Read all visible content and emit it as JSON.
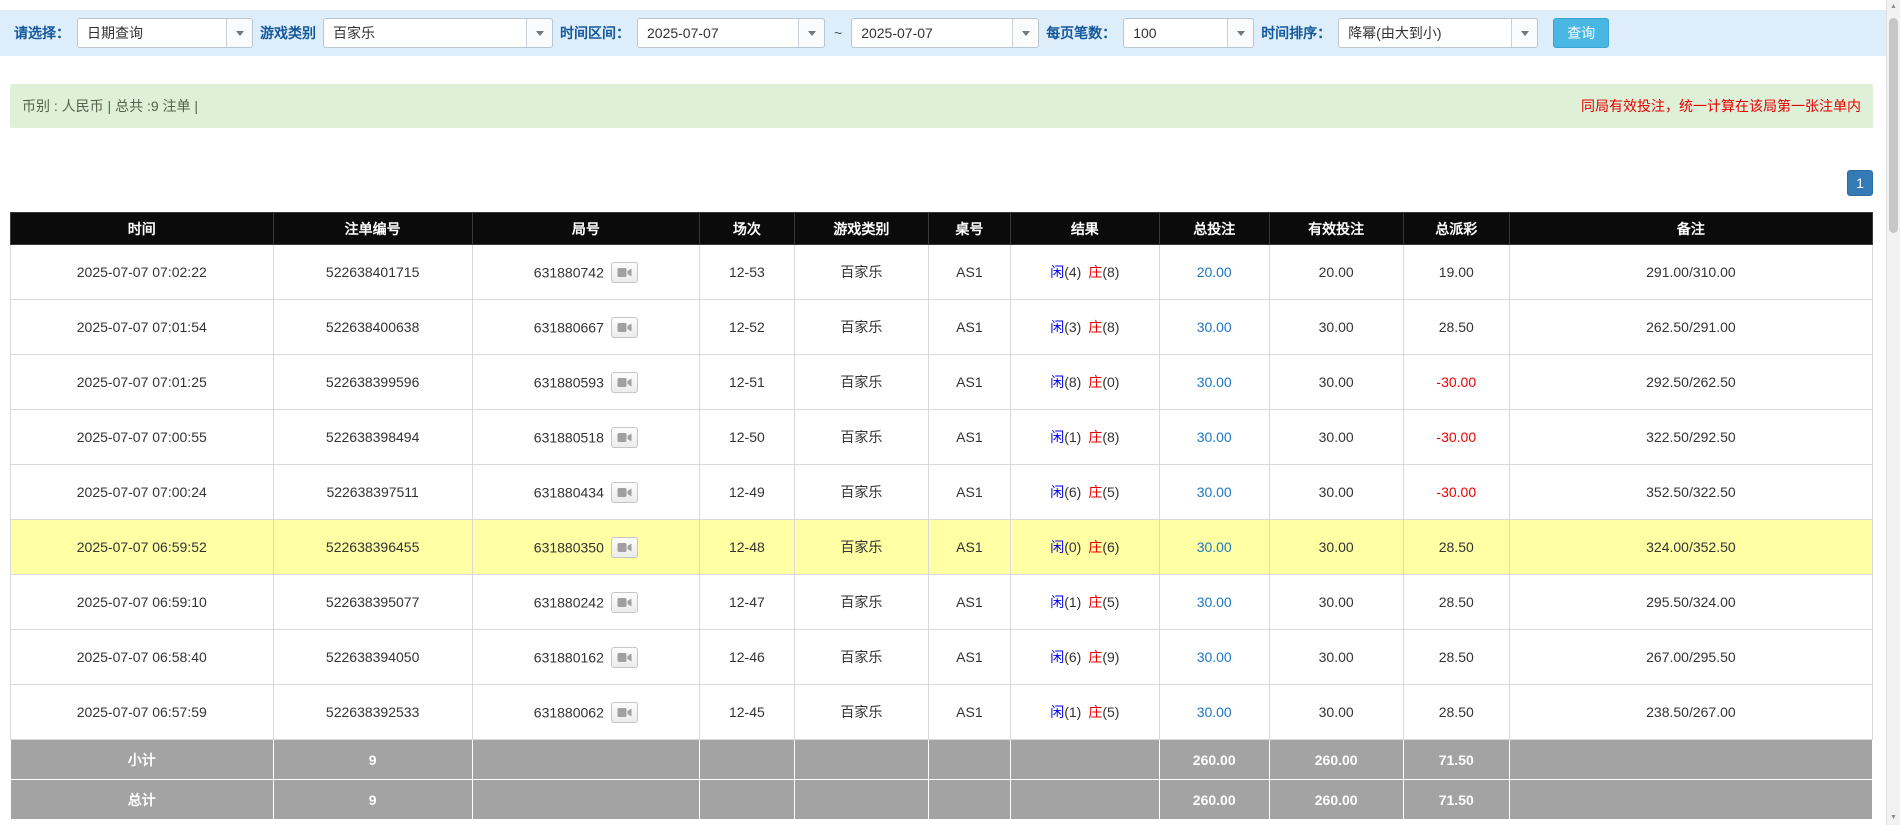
{
  "filter": {
    "select_label": "请选择：",
    "select_value": "日期查询",
    "game_label": "游戏类别",
    "game_value": "百家乐",
    "range_label": "时间区间：",
    "date_from": "2025-07-07",
    "range_sep": "~",
    "date_to": "2025-07-07",
    "per_page_label": "每页笔数：",
    "per_page_value": "100",
    "sort_label": "时间排序：",
    "sort_value": "降幂(由大到小)",
    "query_button": "查询"
  },
  "summary": {
    "left": "币别 : 人民币 | 总共 :9 注单 |",
    "right": "同局有效投注，统一计算在该局第一张注单内"
  },
  "pagination": {
    "current_page": "1"
  },
  "table": {
    "headers": [
      "时间",
      "注单编号",
      "局号",
      "场次",
      "游戏类别",
      "桌号",
      "结果",
      "总投注",
      "有效投注",
      "总派彩",
      "备注"
    ],
    "rows": [
      {
        "time": "2025-07-07 07:02:22",
        "bet_id": "522638401715",
        "round": "631880742",
        "session": "12-53",
        "game": "百家乐",
        "table_no": "AS1",
        "player": "闲",
        "player_score": "(4)",
        "banker": "庄",
        "banker_score": "(8)",
        "total_bet": "20.00",
        "valid_bet": "20.00",
        "payout": "19.00",
        "remark": "291.00/310.00",
        "highlighted": false
      },
      {
        "time": "2025-07-07 07:01:54",
        "bet_id": "522638400638",
        "round": "631880667",
        "session": "12-52",
        "game": "百家乐",
        "table_no": "AS1",
        "player": "闲",
        "player_score": "(3)",
        "banker": "庄",
        "banker_score": "(8)",
        "total_bet": "30.00",
        "valid_bet": "30.00",
        "payout": "28.50",
        "remark": "262.50/291.00",
        "highlighted": false
      },
      {
        "time": "2025-07-07 07:01:25",
        "bet_id": "522638399596",
        "round": "631880593",
        "session": "12-51",
        "game": "百家乐",
        "table_no": "AS1",
        "player": "闲",
        "player_score": "(8)",
        "banker": "庄",
        "banker_score": "(0)",
        "total_bet": "30.00",
        "valid_bet": "30.00",
        "payout": "-30.00",
        "remark": "292.50/262.50",
        "highlighted": false
      },
      {
        "time": "2025-07-07 07:00:55",
        "bet_id": "522638398494",
        "round": "631880518",
        "session": "12-50",
        "game": "百家乐",
        "table_no": "AS1",
        "player": "闲",
        "player_score": "(1)",
        "banker": "庄",
        "banker_score": "(8)",
        "total_bet": "30.00",
        "valid_bet": "30.00",
        "payout": "-30.00",
        "remark": "322.50/292.50",
        "highlighted": false
      },
      {
        "time": "2025-07-07 07:00:24",
        "bet_id": "522638397511",
        "round": "631880434",
        "session": "12-49",
        "game": "百家乐",
        "table_no": "AS1",
        "player": "闲",
        "player_score": "(6)",
        "banker": "庄",
        "banker_score": "(5)",
        "total_bet": "30.00",
        "valid_bet": "30.00",
        "payout": "-30.00",
        "remark": "352.50/322.50",
        "highlighted": false
      },
      {
        "time": "2025-07-07 06:59:52",
        "bet_id": "522638396455",
        "round": "631880350",
        "session": "12-48",
        "game": "百家乐",
        "table_no": "AS1",
        "player": "闲",
        "player_score": "(0)",
        "banker": "庄",
        "banker_score": "(6)",
        "total_bet": "30.00",
        "valid_bet": "30.00",
        "payout": "28.50",
        "remark": "324.00/352.50",
        "highlighted": true
      },
      {
        "time": "2025-07-07 06:59:10",
        "bet_id": "522638395077",
        "round": "631880242",
        "session": "12-47",
        "game": "百家乐",
        "table_no": "AS1",
        "player": "闲",
        "player_score": "(1)",
        "banker": "庄",
        "banker_score": "(5)",
        "total_bet": "30.00",
        "valid_bet": "30.00",
        "payout": "28.50",
        "remark": "295.50/324.00",
        "highlighted": false
      },
      {
        "time": "2025-07-07 06:58:40",
        "bet_id": "522638394050",
        "round": "631880162",
        "session": "12-46",
        "game": "百家乐",
        "table_no": "AS1",
        "player": "闲",
        "player_score": "(6)",
        "banker": "庄",
        "banker_score": "(9)",
        "total_bet": "30.00",
        "valid_bet": "30.00",
        "payout": "28.50",
        "remark": "267.00/295.50",
        "highlighted": false
      },
      {
        "time": "2025-07-07 06:57:59",
        "bet_id": "522638392533",
        "round": "631880062",
        "session": "12-45",
        "game": "百家乐",
        "table_no": "AS1",
        "player": "闲",
        "player_score": "(1)",
        "banker": "庄",
        "banker_score": "(5)",
        "total_bet": "30.00",
        "valid_bet": "30.00",
        "payout": "28.50",
        "remark": "238.50/267.00",
        "highlighted": false
      }
    ],
    "subtotal": {
      "label": "小计",
      "count": "9",
      "total_bet": "260.00",
      "valid_bet": "260.00",
      "payout": "71.50"
    },
    "total": {
      "label": "总计",
      "count": "9",
      "total_bet": "260.00",
      "valid_bet": "260.00",
      "payout": "71.50"
    }
  }
}
